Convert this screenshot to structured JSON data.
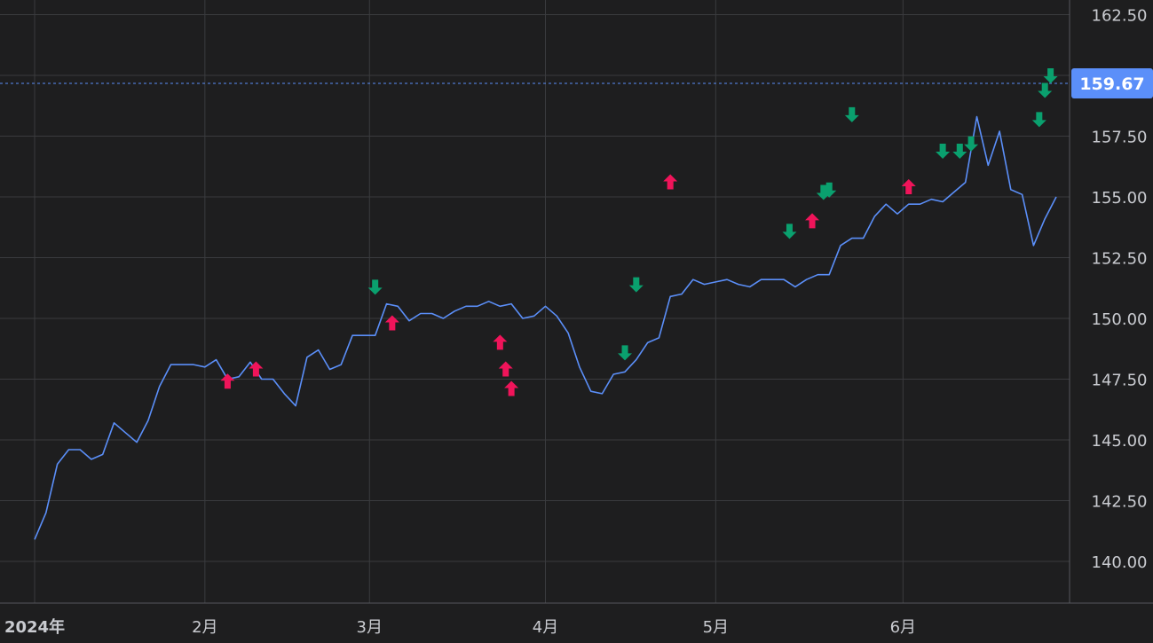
{
  "colors": {
    "background": "#1e1e1f",
    "grid": "#3a3b3e",
    "line": "#5b8ff9",
    "current_label_bg": "#5b8ff9",
    "arrow_up": "#f0145a",
    "arrow_down": "#0aa06e",
    "tick_text": "#c9cbd0"
  },
  "chart_data": {
    "type": "line",
    "x_axis_ticks": [
      {
        "date": "2024-01-02",
        "label": "2024年",
        "bold": true
      },
      {
        "date": "2024-02-01",
        "label": "2月"
      },
      {
        "date": "2024-03-01",
        "label": "3月"
      },
      {
        "date": "2024-04-01",
        "label": "4月"
      },
      {
        "date": "2024-05-01",
        "label": "5月"
      },
      {
        "date": "2024-06-03",
        "label": "6月"
      }
    ],
    "y_axis_ticks": [
      "140.00",
      "142.50",
      "145.00",
      "147.50",
      "150.00",
      "152.50",
      "155.00",
      "157.50",
      "160.00",
      "162.50"
    ],
    "ylim": [
      138,
      163.2
    ],
    "xlim": [
      "2024-01-02",
      "2024-06-30"
    ],
    "grid": true,
    "current_value": "159.67",
    "series": [
      {
        "points": [
          [
            "2024-01-02",
            140.9
          ],
          [
            "2024-01-04",
            142.0
          ],
          [
            "2024-01-05",
            143.0
          ],
          [
            "2024-01-06",
            144.0
          ],
          [
            "2024-01-08",
            144.6
          ],
          [
            "2024-01-10",
            144.6
          ],
          [
            "2024-01-12",
            144.2
          ],
          [
            "2024-01-14",
            144.4
          ],
          [
            "2024-01-16",
            145.7
          ],
          [
            "2024-01-18",
            145.3
          ],
          [
            "2024-01-20",
            144.9
          ],
          [
            "2024-01-22",
            145.8
          ],
          [
            "2024-01-24",
            147.2
          ],
          [
            "2024-01-26",
            148.1
          ],
          [
            "2024-01-28",
            148.1
          ],
          [
            "2024-01-30",
            148.1
          ],
          [
            "2024-02-01",
            148.0
          ],
          [
            "2024-02-03",
            148.3
          ],
          [
            "2024-02-05",
            147.5
          ],
          [
            "2024-02-07",
            147.6
          ],
          [
            "2024-02-09",
            148.2
          ],
          [
            "2024-02-11",
            147.5
          ],
          [
            "2024-02-13",
            147.5
          ],
          [
            "2024-02-15",
            146.9
          ],
          [
            "2024-02-17",
            146.4
          ],
          [
            "2024-02-19",
            148.4
          ],
          [
            "2024-02-21",
            148.7
          ],
          [
            "2024-02-23",
            147.9
          ],
          [
            "2024-02-25",
            148.1
          ],
          [
            "2024-02-27",
            149.3
          ],
          [
            "2024-02-29",
            149.3
          ],
          [
            "2024-03-02",
            149.3
          ],
          [
            "2024-03-04",
            150.6
          ],
          [
            "2024-03-06",
            150.5
          ],
          [
            "2024-03-08",
            149.9
          ],
          [
            "2024-03-10",
            150.2
          ],
          [
            "2024-03-12",
            150.2
          ],
          [
            "2024-03-14",
            150.0
          ],
          [
            "2024-03-16",
            150.3
          ],
          [
            "2024-03-18",
            150.5
          ],
          [
            "2024-03-20",
            150.5
          ],
          [
            "2024-03-22",
            150.7
          ],
          [
            "2024-03-24",
            150.5
          ],
          [
            "2024-03-26",
            150.6
          ],
          [
            "2024-03-28",
            150.0
          ],
          [
            "2024-03-30",
            150.1
          ],
          [
            "2024-04-01",
            150.5
          ],
          [
            "2024-04-03",
            150.1
          ],
          [
            "2024-04-05",
            149.4
          ],
          [
            "2024-04-07",
            148.0
          ],
          [
            "2024-04-09",
            147.0
          ],
          [
            "2024-04-11",
            146.9
          ],
          [
            "2024-04-13",
            147.7
          ],
          [
            "2024-04-15",
            147.8
          ],
          [
            "2024-04-17",
            148.3
          ],
          [
            "2024-04-19",
            149.0
          ],
          [
            "2024-04-21",
            149.2
          ],
          [
            "2024-04-23",
            150.9
          ],
          [
            "2024-04-25",
            151.0
          ],
          [
            "2024-04-27",
            151.6
          ],
          [
            "2024-04-29",
            151.4
          ],
          [
            "2024-05-01",
            151.5
          ],
          [
            "2024-05-03",
            151.6
          ],
          [
            "2024-05-05",
            151.4
          ],
          [
            "2024-05-07",
            151.3
          ],
          [
            "2024-05-09",
            151.6
          ],
          [
            "2024-05-11",
            151.6
          ],
          [
            "2024-05-13",
            151.6
          ],
          [
            "2024-05-15",
            151.3
          ],
          [
            "2024-05-17",
            151.6
          ],
          [
            "2024-05-19",
            151.8
          ],
          [
            "2024-05-21",
            151.8
          ],
          [
            "2024-05-23",
            153.0
          ],
          [
            "2024-05-25",
            153.3
          ],
          [
            "2024-05-27",
            153.3
          ],
          [
            "2024-05-29",
            154.2
          ],
          [
            "2024-05-31",
            154.7
          ],
          [
            "2024-06-02",
            154.3
          ],
          [
            "2024-06-04",
            154.7
          ],
          [
            "2024-06-06",
            154.7
          ],
          [
            "2024-06-08",
            154.9
          ],
          [
            "2024-06-10",
            154.8
          ],
          [
            "2024-06-12",
            155.2
          ],
          [
            "2024-06-14",
            155.6
          ],
          [
            "2024-06-16",
            158.3
          ],
          [
            "2024-06-18",
            156.3
          ],
          [
            "2024-06-20",
            157.7
          ],
          [
            "2024-06-22",
            155.3
          ],
          [
            "2024-06-24",
            155.1
          ],
          [
            "2024-06-26",
            153.0
          ],
          [
            "2024-06-28",
            154.1
          ],
          [
            "2024-06-30",
            155.0
          ]
        ]
      }
    ],
    "buy_arrows": [
      [
        "2024-02-05",
        147.4
      ],
      [
        "2024-02-10",
        147.9
      ],
      [
        "2024-03-05",
        149.8
      ],
      [
        "2024-03-24",
        149.0
      ],
      [
        "2024-03-25",
        147.9
      ],
      [
        "2024-03-26",
        147.1
      ],
      [
        "2024-04-23",
        155.6
      ],
      [
        "2024-05-18",
        154.0
      ],
      [
        "2024-06-04",
        155.4
      ]
    ],
    "sell_arrows": [
      [
        "2024-03-02",
        151.3
      ],
      [
        "2024-04-15",
        148.6
      ],
      [
        "2024-04-17",
        151.4
      ],
      [
        "2024-05-14",
        153.6
      ],
      [
        "2024-05-20",
        155.2
      ],
      [
        "2024-05-21",
        155.3
      ],
      [
        "2024-05-25",
        158.4
      ],
      [
        "2024-06-10",
        156.9
      ],
      [
        "2024-06-13",
        156.9
      ],
      [
        "2024-06-15",
        157.2
      ],
      [
        "2024-06-27",
        158.2
      ],
      [
        "2024-06-28",
        159.4
      ],
      [
        "2024-06-29",
        160.0
      ]
    ]
  }
}
